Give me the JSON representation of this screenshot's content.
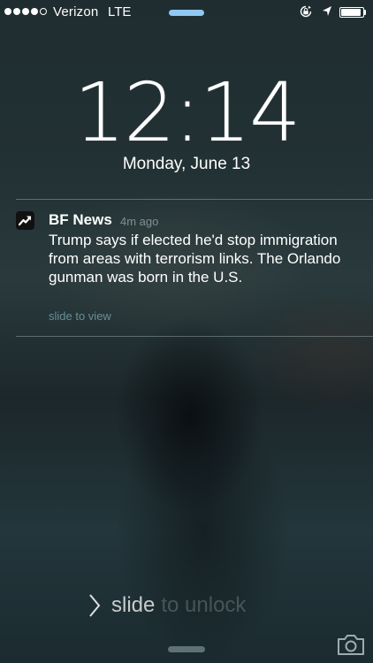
{
  "status_bar": {
    "signal_bars_filled": 4,
    "signal_bars_total": 5,
    "carrier": "Verizon",
    "network": "LTE",
    "battery_level": 0.9,
    "icons": [
      "rotation-lock-icon",
      "location-arrow-icon",
      "battery-icon"
    ]
  },
  "lock_screen": {
    "time": "12:14",
    "date": "Monday, June 13"
  },
  "notification": {
    "app_icon": "trending-arrow-icon",
    "app_name": "BF News",
    "time_ago": "4m ago",
    "message": "Trump says if elected he'd stop immigration from areas with terrorism links. The Orlando gunman was born in the U.S.",
    "action_hint": "slide to view"
  },
  "unlock": {
    "slide_word": "slide",
    "rest": "to unlock"
  },
  "colors": {
    "top_handle": "#8fc8f0",
    "notification_hint": "#96c8d7"
  }
}
